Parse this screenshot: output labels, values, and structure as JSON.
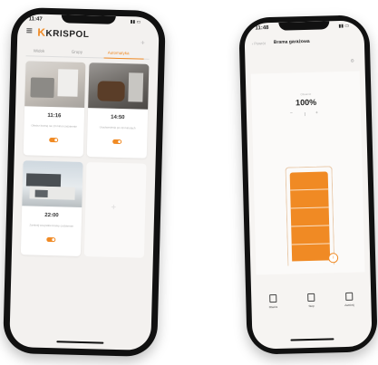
{
  "left_phone": {
    "status_time": "11:47",
    "logo_text": "KRISPOL",
    "tabs": [
      {
        "label": "Widok"
      },
      {
        "label": "Grupy"
      },
      {
        "label": "Automatyka"
      }
    ],
    "add_symbol": "+",
    "cards": [
      {
        "time": "11:16",
        "description": "Otwórz bramę na 10 minut codziennie",
        "enabled": true
      },
      {
        "time": "14:50",
        "description": "Uruchomienie po 19 minutach",
        "enabled": true
      },
      {
        "time": "22:00",
        "description": "Zamknij wszystkie bramy codziennie",
        "enabled": true
      }
    ],
    "empty_plus": "+"
  },
  "right_phone": {
    "status_time": "11:48",
    "back_label": "Powrót",
    "title": "Brama garażowa",
    "settings_symbol": "⚙",
    "open_label": "Otwarcie",
    "percent": "100%",
    "stepper": {
      "minus": "−",
      "plus": "+"
    },
    "handle_symbol": "↕",
    "actions": [
      {
        "label": "Otwórz"
      },
      {
        "label": "Stop"
      },
      {
        "label": "Zamknij"
      }
    ]
  },
  "colors": {
    "accent": "#f08a24",
    "phone": "#111111",
    "screen": "#f3f1ef"
  }
}
